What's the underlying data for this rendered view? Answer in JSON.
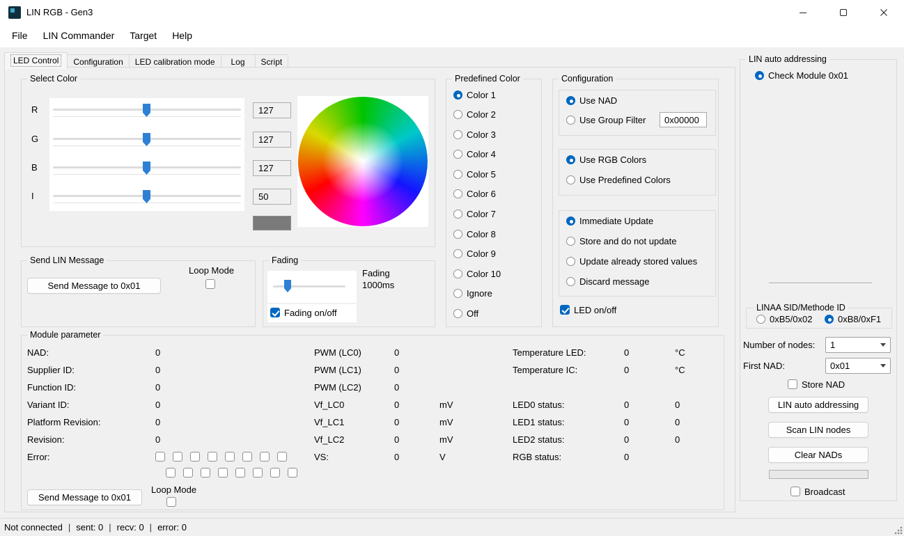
{
  "window": {
    "title": "LIN RGB - Gen3"
  },
  "menu": {
    "items": [
      "File",
      "LIN Commander",
      "Target",
      "Help"
    ]
  },
  "tabs": {
    "items": [
      "LED Control",
      "Configuration",
      "LED calibration mode",
      "Log",
      "Script"
    ],
    "active_index": 0
  },
  "colors": {
    "accent": "#0067c0",
    "slider_thumb": "#2e80d4",
    "swatch": "#7a7a7a"
  },
  "select_color": {
    "title": "Select Color",
    "sliders": [
      {
        "label": "R",
        "value": "127"
      },
      {
        "label": "G",
        "value": "127"
      },
      {
        "label": "B",
        "value": "127"
      },
      {
        "label": "I",
        "value": "50"
      }
    ],
    "swatch_color": "#7a7a7a"
  },
  "send_lin": {
    "title": "Send LIN Message",
    "button": "Send Message to 0x01",
    "loop_label": "Loop Mode",
    "loop_checked": false
  },
  "fading": {
    "title": "Fading",
    "label_line1": "Fading",
    "label_line2": "1000ms",
    "checkbox_label": "Fading on/off",
    "checkbox_checked": true
  },
  "predefined": {
    "title": "Predefined Color",
    "options": [
      {
        "label": "Color 1",
        "selected": true
      },
      {
        "label": "Color 2",
        "selected": false
      },
      {
        "label": "Color 3",
        "selected": false
      },
      {
        "label": "Color 4",
        "selected": false
      },
      {
        "label": "Color 5",
        "selected": false
      },
      {
        "label": "Color 6",
        "selected": false
      },
      {
        "label": "Color 7",
        "selected": false
      },
      {
        "label": "Color 8",
        "selected": false
      },
      {
        "label": "Color 9",
        "selected": false
      },
      {
        "label": "Color 10",
        "selected": false
      },
      {
        "label": "Ignore",
        "selected": false
      },
      {
        "label": "Off",
        "selected": false
      }
    ]
  },
  "config": {
    "title": "Configuration",
    "nad": {
      "use_nad": {
        "label": "Use NAD",
        "selected": true
      },
      "group_filter": {
        "label": "Use Group Filter",
        "selected": false
      },
      "filter_value": "0x00000"
    },
    "colors": {
      "rgb": {
        "label": "Use RGB Colors",
        "selected": true
      },
      "predef": {
        "label": "Use Predefined Colors",
        "selected": false
      }
    },
    "update": [
      {
        "label": "Immediate Update",
        "selected": true
      },
      {
        "label": "Store and do not update",
        "selected": false
      },
      {
        "label": "Update already stored values",
        "selected": false
      },
      {
        "label": "Discard message",
        "selected": false
      }
    ],
    "led": {
      "label": "LED on/off",
      "checked": true
    }
  },
  "module": {
    "title": "Module parameter",
    "col1": [
      {
        "label": "NAD:",
        "value": "0"
      },
      {
        "label": "Supplier ID:",
        "value": "0"
      },
      {
        "label": "Function ID:",
        "value": "0"
      },
      {
        "label": "Variant ID:",
        "value": "0"
      },
      {
        "label": "Platform Revision:",
        "value": "0"
      },
      {
        "label": "Revision:",
        "value": "0"
      },
      {
        "label": "Error:",
        "value": ""
      }
    ],
    "col2": [
      {
        "label": "PWM (LC0)",
        "value": "0",
        "unit": ""
      },
      {
        "label": "PWM (LC1)",
        "value": "0",
        "unit": ""
      },
      {
        "label": "PWM (LC2)",
        "value": "0",
        "unit": ""
      },
      {
        "label": "Vf_LC0",
        "value": "0",
        "unit": "mV"
      },
      {
        "label": "Vf_LC1",
        "value": "0",
        "unit": "mV"
      },
      {
        "label": "Vf_LC2",
        "value": "0",
        "unit": "mV"
      },
      {
        "label": "VS:",
        "value": "0",
        "unit": "V"
      }
    ],
    "col3": [
      {
        "label": "Temperature LED:",
        "value": "0",
        "value2": "°C"
      },
      {
        "label": "Temperature IC:",
        "value": "0",
        "value2": "°C"
      },
      {
        "label": "",
        "value": "",
        "value2": ""
      },
      {
        "label": "LED0 status:",
        "value": "0",
        "value2": "0"
      },
      {
        "label": "LED1 status:",
        "value": "0",
        "value2": "0"
      },
      {
        "label": "LED2 status:",
        "value": "0",
        "value2": "0"
      },
      {
        "label": "RGB status:",
        "value": "0",
        "value2": ""
      }
    ],
    "button": "Send Message to 0x01",
    "loop_label": "Loop Mode",
    "loop_checked": false
  },
  "sidebar": {
    "title": "LIN auto addressing",
    "check_module": {
      "label": "Check Module 0x01",
      "selected": true
    },
    "sid_group": {
      "title": "LINAA SID/Methode ID",
      "options": [
        {
          "label": "0xB5/0x02",
          "selected": false
        },
        {
          "label": "0xB8/0xF1",
          "selected": true
        }
      ]
    },
    "nodes": {
      "label": "Number of nodes:",
      "value": "1"
    },
    "first_nad": {
      "label": "First NAD:",
      "value": "0x01"
    },
    "store_nad": {
      "label": "Store NAD",
      "checked": false
    },
    "btn_auto": "LIN auto addressing",
    "btn_scan": "Scan LIN nodes",
    "btn_clear": "Clear NADs",
    "broadcast": {
      "label": "Broadcast",
      "checked": false
    }
  },
  "status": {
    "parts": [
      "Not connected",
      "sent:  0",
      "recv:  0",
      "error:  0"
    ],
    "sep": "|"
  }
}
